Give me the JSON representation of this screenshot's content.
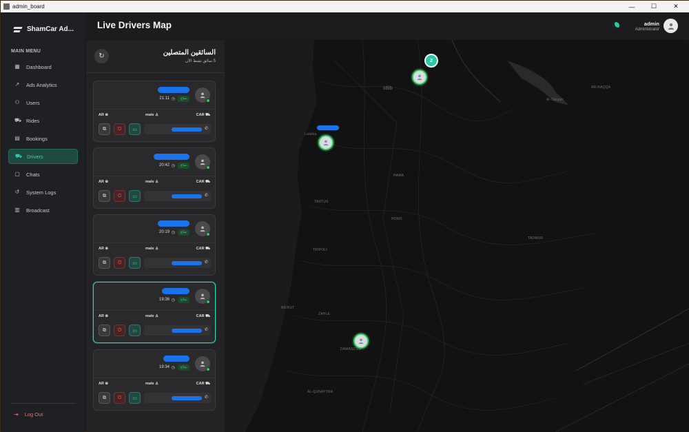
{
  "window": {
    "title": "admin_board",
    "controls": [
      "—",
      "☐",
      "✕"
    ]
  },
  "brand": {
    "name": "ShamCar Ad..."
  },
  "sidebar": {
    "menu_heading": "MAIN MENU",
    "items": [
      {
        "label": "Dashboard",
        "icon": "grid-icon"
      },
      {
        "label": "Ads Analytics",
        "icon": "trend-icon"
      },
      {
        "label": "Users",
        "icon": "users-icon"
      },
      {
        "label": "Rides",
        "icon": "car-icon"
      },
      {
        "label": "Bookings",
        "icon": "calendar-icon"
      },
      {
        "label": "Drivers",
        "icon": "driver-icon",
        "active": true
      },
      {
        "label": "Chats",
        "icon": "chat-icon"
      },
      {
        "label": "System Logs",
        "icon": "history-icon"
      },
      {
        "label": "Broadcast",
        "icon": "broadcast-icon"
      }
    ],
    "logout": "Log Out"
  },
  "header": {
    "title": "Live Drivers Map",
    "user": {
      "name": "admin",
      "role": "Administrator"
    }
  },
  "panel": {
    "title": "السائقين المتصلين",
    "subtitle": "5 سائق نشط الآن",
    "drivers": [
      {
        "time": "21:11",
        "status": "متاح",
        "lang": "AR",
        "gender": "male",
        "vehicle": "CAR"
      },
      {
        "time": "20:42",
        "status": "متاح",
        "lang": "AR",
        "gender": "male",
        "vehicle": "CAR"
      },
      {
        "time": "20:19",
        "status": "متاح",
        "lang": "AR",
        "gender": "male",
        "vehicle": "CAR"
      },
      {
        "time": "19:36",
        "status": "متاح",
        "lang": "AR",
        "gender": "male",
        "vehicle": "CAR",
        "selected": true
      },
      {
        "time": "19:34",
        "status": "متاح",
        "lang": "AR",
        "gender": "male",
        "vehicle": "CAR"
      }
    ]
  },
  "map": {
    "cluster_count": "2",
    "labels": [
      "Idlib",
      "Al-Tabqah",
      "AR-RAQQA",
      "Latakia",
      "HAMA",
      "TARTUS",
      "HOMS",
      "TRIPOLI",
      "TADMUR",
      "DAMASCUS",
      "ZAHLE",
      "AL-QUNAYTRA",
      "BEIRUT"
    ]
  },
  "colors": {
    "accent": "#2cc7a5",
    "online": "#35c46a",
    "danger": "#ff5f5f"
  }
}
